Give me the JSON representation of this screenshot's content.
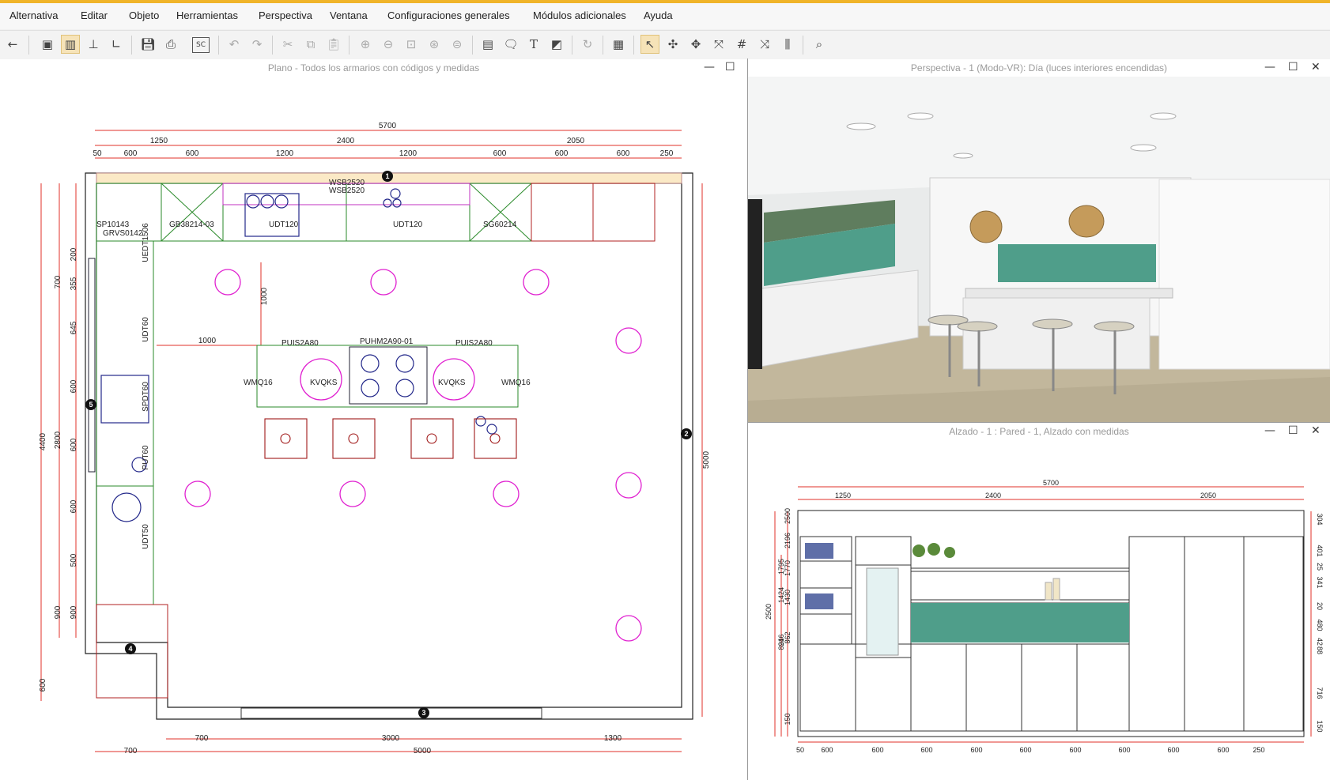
{
  "menu": [
    "Alternativa",
    "Editar",
    "Objeto",
    "Herramientas",
    "Perspectiva",
    "Ventana",
    "Configuraciones generales",
    "Módulos adicionales",
    "Ayuda"
  ],
  "toolbar": {
    "icons": [
      "back-arrow-icon",
      "view-plan-icon",
      "view-wall-icon",
      "view-elevation-icon",
      "view-floor-icon",
      "save-icon",
      "print-icon",
      "sc-icon",
      "undo-icon",
      "redo-icon",
      "cut-icon",
      "copy-icon",
      "paste-icon",
      "zoom-in-icon",
      "zoom-out-icon",
      "zoom-window-icon",
      "zoom-all-icon",
      "zoom-previous-icon",
      "list-icon",
      "note-icon",
      "text-icon",
      "dimension-icon",
      "refresh-icon",
      "calculator-icon",
      "select-arrow-icon",
      "move-icon",
      "rotate-icon",
      "align-icon",
      "grid-icon",
      "measure-icon",
      "mirror-icon",
      "camera-icon"
    ],
    "sc_label": "SC"
  },
  "panes": {
    "plan": {
      "title": "Plano - Todos los armarios con códigos y medidas"
    },
    "perspective": {
      "title": "Perspectiva - 1 (Modo-VR): Día (luces interiores encendidas)"
    },
    "elevation": {
      "title": "Alzado - 1 : Pared - 1, Alzado con medidas"
    }
  },
  "window_controls": {
    "minimize": "—",
    "maximize": "☐",
    "close": "✕"
  },
  "plan": {
    "dims_top": [
      "5700",
      "1250",
      "2400",
      "2050",
      "50",
      "600",
      "600",
      "1200",
      "1200",
      "600",
      "600",
      "600",
      "250"
    ],
    "dims_bottom": [
      "700",
      "3000",
      "1300",
      "700",
      "5000"
    ],
    "dims_left": [
      "700",
      "200",
      "355",
      "645",
      "600",
      "2800",
      "600",
      "600",
      "500",
      "900",
      "900",
      "4400",
      "600"
    ],
    "dim_right": "5000",
    "dim_inner": [
      "1000",
      "1000"
    ],
    "codes": [
      "SP10143",
      "GB38214-03",
      "UDT120",
      "UDT120",
      "SG60214",
      "WSB2520",
      "WSB2520",
      "UEDT1506",
      "UDT60",
      "SPDT60",
      "PUT60",
      "UDT50",
      "PUIS2A80",
      "PUHM2A90-01",
      "PUIS2A80",
      "WMQ16",
      "KVQKS",
      "KVQKS",
      "WMQ16",
      "GRVS0142"
    ],
    "markers": [
      "1",
      "2",
      "3",
      "4",
      "5"
    ]
  },
  "elevation": {
    "dims_top": [
      "5700",
      "1250",
      "2400",
      "2050"
    ],
    "dims_bottom": [
      "50",
      "600",
      "600",
      "600",
      "600",
      "600",
      "600",
      "600",
      "600",
      "600",
      "250"
    ],
    "dims_left": [
      "2500",
      "2196",
      "1795",
      "1770",
      "1424",
      "1430",
      "2500",
      "916",
      "862",
      "824",
      "150"
    ],
    "dims_right": [
      "304",
      "401",
      "25",
      "341",
      "20",
      "480",
      "42",
      "88",
      "716",
      "150"
    ]
  }
}
